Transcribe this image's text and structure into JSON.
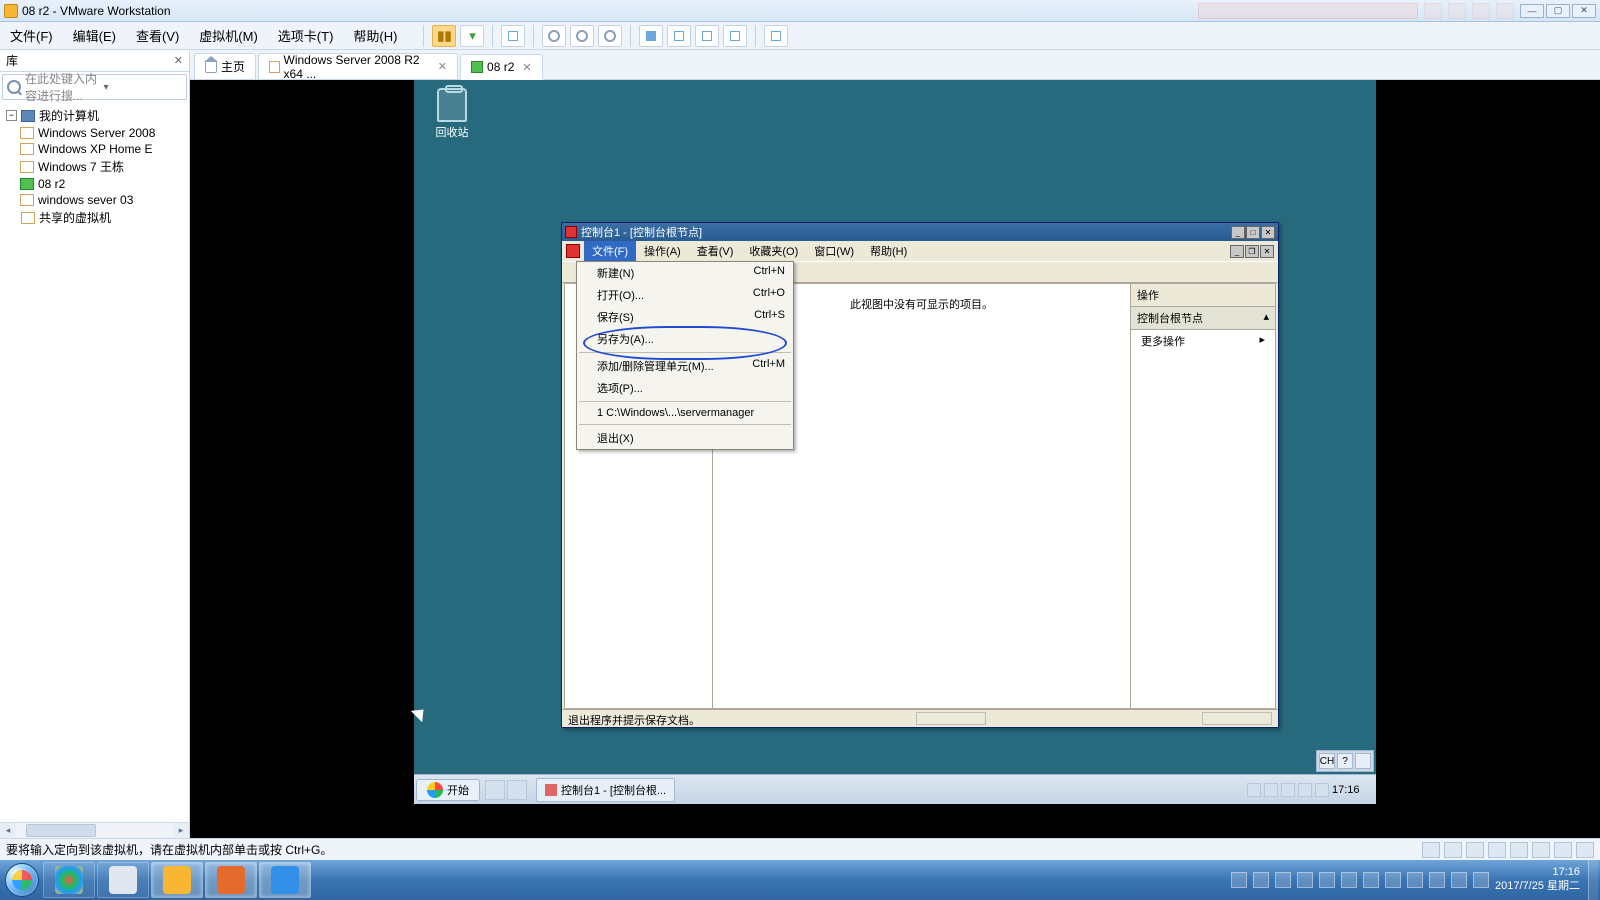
{
  "outer": {
    "title": "08 r2 - VMware Workstation"
  },
  "menu": {
    "file": "文件(F)",
    "edit": "编辑(E)",
    "view": "查看(V)",
    "vm": "虚拟机(M)",
    "tabs": "选项卡(T)",
    "help": "帮助(H)"
  },
  "sidebar": {
    "title": "库",
    "search_placeholder": "在此处键入内容进行搜...",
    "root": "我的计算机",
    "items": [
      "Windows Server 2008",
      "Windows XP Home E",
      "Windows 7 王栋",
      "08 r2",
      "windows sever 03"
    ],
    "shared": "共享的虚拟机"
  },
  "tabs": {
    "home": "主页",
    "t1": "Windows Server 2008 R2 x64 ...",
    "t2": "08 r2"
  },
  "guest": {
    "recycle": "回收站",
    "mmc_title": "控制台1 - [控制台根节点]",
    "mmc_menu": {
      "file": "文件(F)",
      "action": "操作(A)",
      "view": "查看(V)",
      "fav": "收藏夹(O)",
      "window": "窗口(W)",
      "help": "帮助(H)"
    },
    "drop": {
      "new": "新建(N)",
      "new_k": "Ctrl+N",
      "open": "打开(O)...",
      "open_k": "Ctrl+O",
      "save": "保存(S)",
      "save_k": "Ctrl+S",
      "saveas": "另存为(A)...",
      "snap": "添加/删除管理单元(M)...",
      "snap_k": "Ctrl+M",
      "opt": "选项(P)...",
      "recent": "1 C:\\Windows\\...\\servermanager",
      "exit": "退出(X)"
    },
    "mmc_center": "此视图中没有可显示的项目。",
    "mmc_actions": {
      "title": "操作",
      "root": "控制台根节点",
      "more": "更多操作"
    },
    "mmc_status": "退出程序并提示保存文档。",
    "taskbar": {
      "start": "开始",
      "task1": "控制台1 - [控制台根...",
      "clock": "17:16"
    },
    "lang": "CH"
  },
  "status": {
    "hint": "要将输入定向到该虚拟机，请在虚拟机内部单击或按 Ctrl+G。"
  },
  "host": {
    "time": "17:16",
    "date": "2017/7/25 星期二"
  }
}
